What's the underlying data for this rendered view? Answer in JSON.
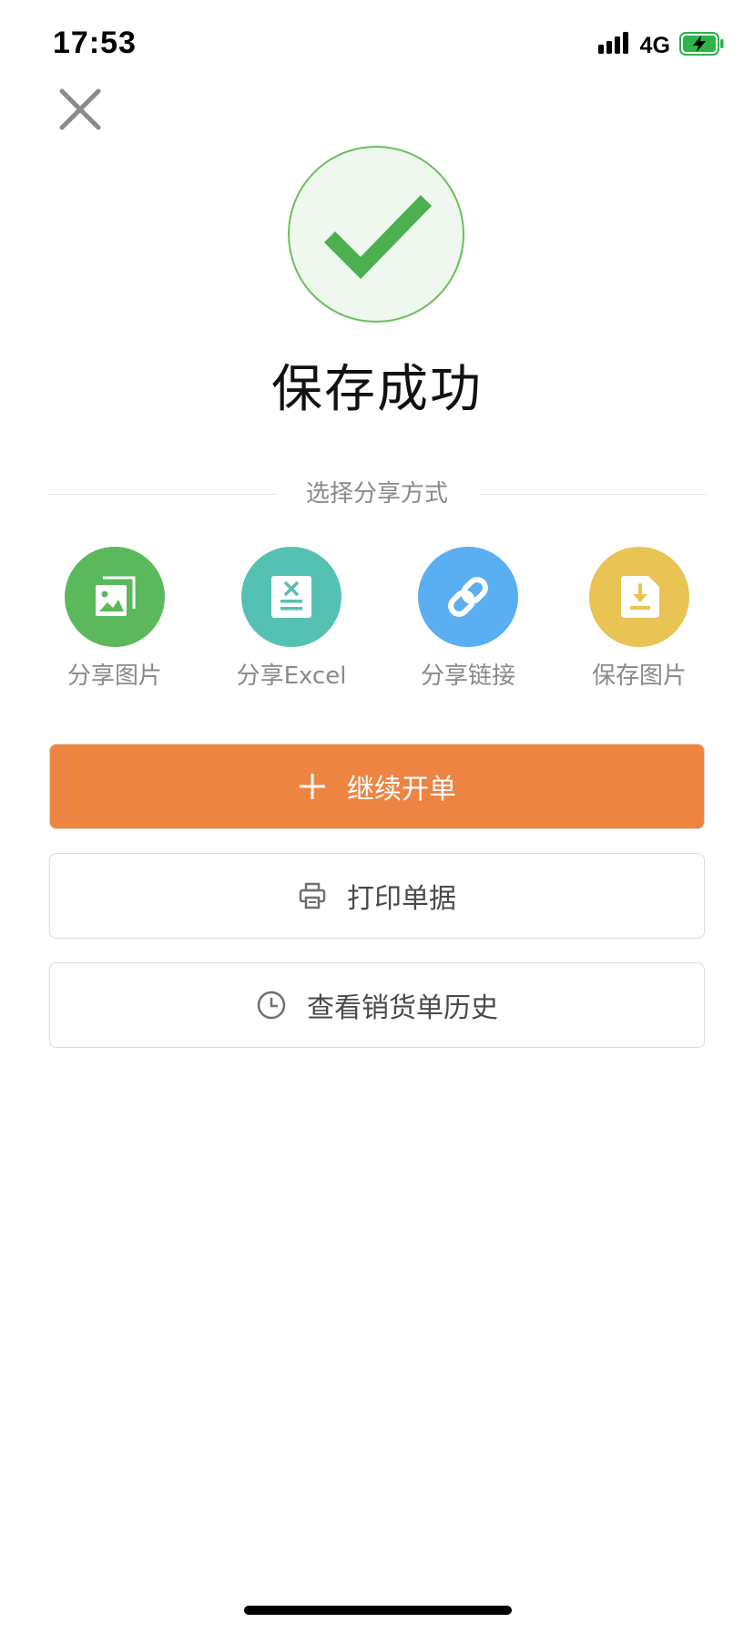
{
  "status_bar": {
    "time": "17:53",
    "network": "4G"
  },
  "header": {
    "close_icon": "close-icon"
  },
  "result": {
    "icon": "check-icon",
    "title": "保存成功",
    "accent": "#4caf50"
  },
  "share": {
    "heading": "选择分享方式",
    "options": [
      {
        "label": "分享图片",
        "icon": "image-icon",
        "color": "#5cb85c"
      },
      {
        "label": "分享Excel",
        "icon": "excel-icon",
        "color": "#55c1b2"
      },
      {
        "label": "分享链接",
        "icon": "link-icon",
        "color": "#5aaef2"
      },
      {
        "label": "保存图片",
        "icon": "download-icon",
        "color": "#e9c353"
      }
    ]
  },
  "actions": {
    "continue_label": "继续开单",
    "continue_icon": "plus-icon",
    "continue_color": "#ee8442",
    "print_label": "打印单据",
    "print_icon": "printer-icon",
    "history_label": "查看销货单历史",
    "history_icon": "clock-icon"
  }
}
